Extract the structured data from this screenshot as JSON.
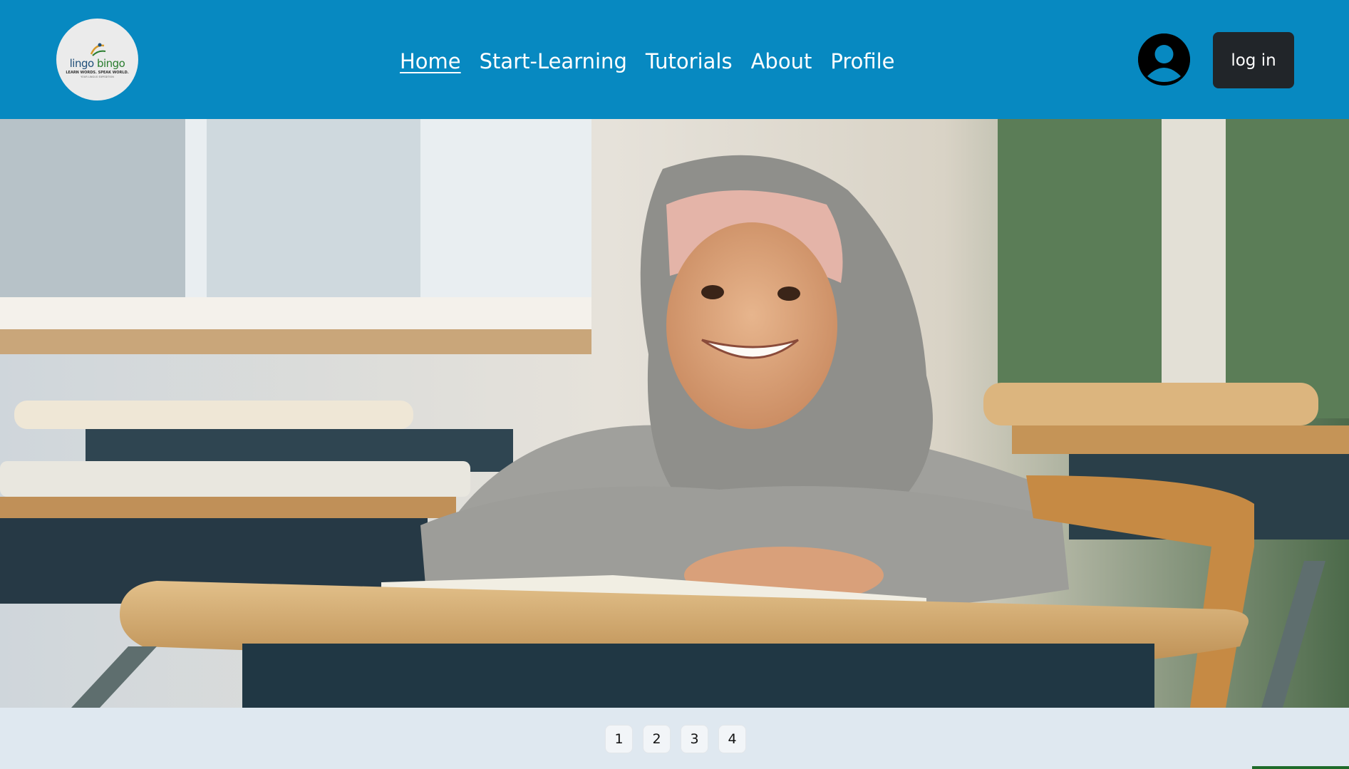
{
  "brand": {
    "name_part1": "lingo",
    "name_part2": "bingo",
    "tagline": "LEARN WORDS. SPEAK WORLD.",
    "subtagline": "YOUR LINGUO EXPEDITION"
  },
  "nav": {
    "items": [
      {
        "label": "Home",
        "active": true
      },
      {
        "label": "Start-Learning",
        "active": false
      },
      {
        "label": "Tutorials",
        "active": false
      },
      {
        "label": "About",
        "active": false
      },
      {
        "label": "Profile",
        "active": false
      }
    ]
  },
  "account": {
    "avatar_icon": "user-circle-icon",
    "login_label": "log in"
  },
  "hero": {
    "image_description_icon": "hero-image"
  },
  "pagination": {
    "pages": [
      "1",
      "2",
      "3",
      "4"
    ]
  },
  "colors": {
    "navbar": "#0789c1",
    "login_button": "#212529",
    "page_background": "#dfe8f0"
  }
}
